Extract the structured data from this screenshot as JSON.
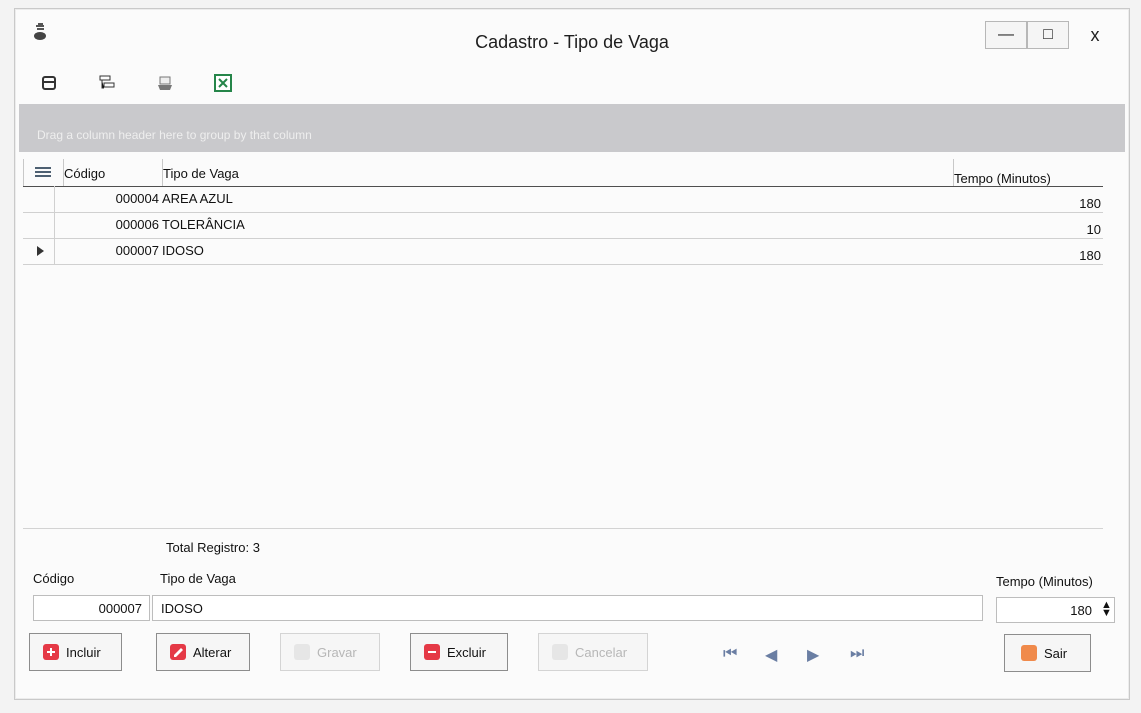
{
  "window": {
    "title": "Cadastro - Tipo de Vaga",
    "controls": [
      "—",
      "□",
      "x"
    ]
  },
  "toolbar": {
    "tools": [
      {
        "name": "database-icon"
      },
      {
        "name": "tree-icon"
      },
      {
        "name": "print-icon"
      },
      {
        "name": "excel-icon"
      }
    ]
  },
  "group_panel": {
    "text": "Drag a column header here to group by that column"
  },
  "grid": {
    "columns": [
      "Código",
      "Tipo de Vaga",
      "Tempo (Minutos)"
    ],
    "rows": [
      {
        "codigo": "000004",
        "tipo": "AREA AZUL",
        "tempo": "180"
      },
      {
        "codigo": "000006",
        "tipo": "TOLERÂNCIA",
        "tempo": "10"
      },
      {
        "codigo": "000007",
        "tipo": "IDOSO",
        "tempo": "180"
      }
    ]
  },
  "summary": {
    "total": "Total Registro: 3"
  },
  "form": {
    "codigo_label": "Código",
    "tipo_label": "Tipo de Vaga",
    "tempo_label": "Tempo (Minutos)",
    "codigo_value": "000007",
    "tipo_value": "IDOSO",
    "tempo_value": "180"
  },
  "actions": {
    "incluir": "Incluir",
    "alterar": "Alterar",
    "gravar": "Gravar",
    "excluir": "Excluir",
    "cancelar": "Cancelar",
    "sair": "Sair"
  },
  "colors": {
    "group_panel": "#c9c9cc",
    "accent_red": "#e53946",
    "nav_blue": "#6a7ea3"
  }
}
